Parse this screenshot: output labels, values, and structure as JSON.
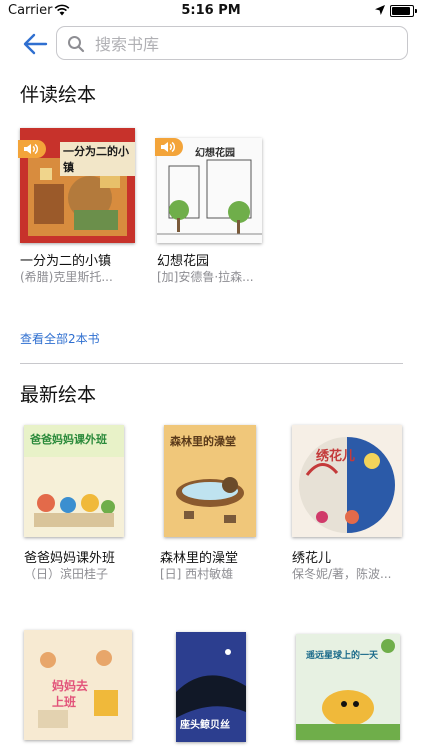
{
  "status": {
    "carrier": "Carrier",
    "time": "5:16 PM"
  },
  "search": {
    "placeholder": "搜索书库"
  },
  "sections": {
    "companion": {
      "title": "伴读绘本",
      "view_all": "查看全部2本书",
      "books": [
        {
          "title": "一分为二的小镇",
          "author": "(希腊)克里斯托...",
          "cover_title": "一分为二的小镇",
          "audio": true
        },
        {
          "title": "幻想花园",
          "author": "[加]安德鲁·拉森...",
          "cover_title": "幻想花园",
          "audio": true
        }
      ]
    },
    "latest": {
      "title": "最新绘本",
      "books": [
        {
          "title": "爸爸妈妈课外班",
          "author": "（日）滨田桂子",
          "cover_title": "爸爸妈妈课外班"
        },
        {
          "title": "森林里的澡堂",
          "author": "[日] 西村敏雄",
          "cover_title": "森林里的澡堂"
        },
        {
          "title": "绣花儿",
          "author": "保冬妮/著，陈波...",
          "cover_title": "绣花儿"
        },
        {
          "title": "",
          "author": "",
          "cover_title": "妈妈去上班"
        },
        {
          "title": "",
          "author": "",
          "cover_title": "座头鲸贝丝"
        },
        {
          "title": "",
          "author": "",
          "cover_title": "遥远星球上的一天"
        }
      ]
    }
  },
  "colors": {
    "accent": "#2f6fd0",
    "audio_badge": "#f3a43a"
  }
}
